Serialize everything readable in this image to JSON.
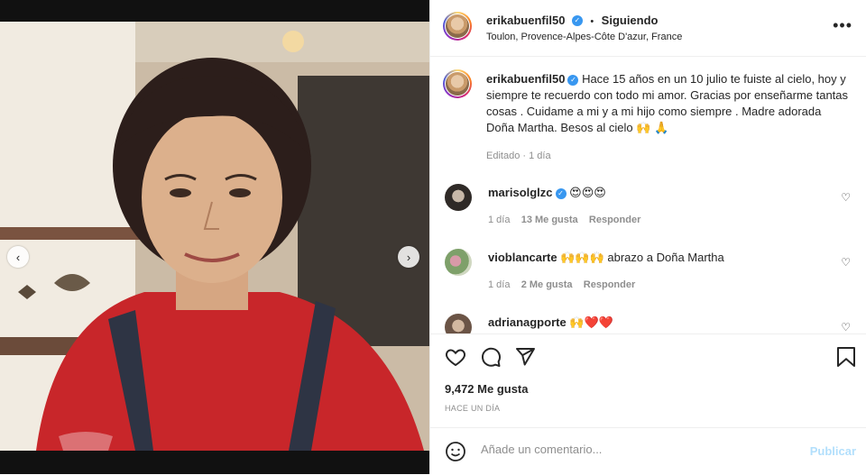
{
  "post": {
    "username": "erikabuenfil50",
    "follow_status": "Siguiendo",
    "separator": "•",
    "location": "Toulon, Provence-Alpes-Côte D'azur, France",
    "more_label": "•••",
    "carousel": {
      "slide_count": 3,
      "active_slide": 2,
      "prev_label": "‹",
      "next_label": "›"
    }
  },
  "caption": {
    "username": "erikabuenfil50",
    "text": "Hace 15 años en un 10 julio te fuiste al cielo, hoy y siempre te recuerdo con todo mi amor. Gracias por enseñarme tantas cosas . Cuidame a mi y a mi hijo como siempre . Madre adorada Doña Martha. Besos al cielo 🙌 🙏",
    "edited": "Editado",
    "time": "1 día"
  },
  "comments": [
    {
      "username": "marisolglzc",
      "text": "😍😍😍",
      "time": "1 día",
      "likes": "13 Me gusta",
      "reply": "Responder",
      "verified": true
    },
    {
      "username": "vioblancarte",
      "text": "🙌🙌🙌 abrazo a Doña Martha",
      "time": "1 día",
      "likes": "2 Me gusta",
      "reply": "Responder",
      "verified": false
    },
    {
      "username": "adrianagporte",
      "text": "🙌❤️❤️",
      "verified": false
    }
  ],
  "actions": {
    "like_icon": "heart-icon",
    "comment_icon": "comment-icon",
    "share_icon": "share-icon",
    "save_icon": "bookmark-icon",
    "likes_count": "9,472 Me gusta",
    "posted": "HACE UN DÍA"
  },
  "composer": {
    "placeholder": "Añade un comentario...",
    "publish_label": "Publicar"
  },
  "colors": {
    "verified": "#3897f0",
    "heart_red": "#ed4956",
    "publish_disabled": "#b2dffc"
  }
}
